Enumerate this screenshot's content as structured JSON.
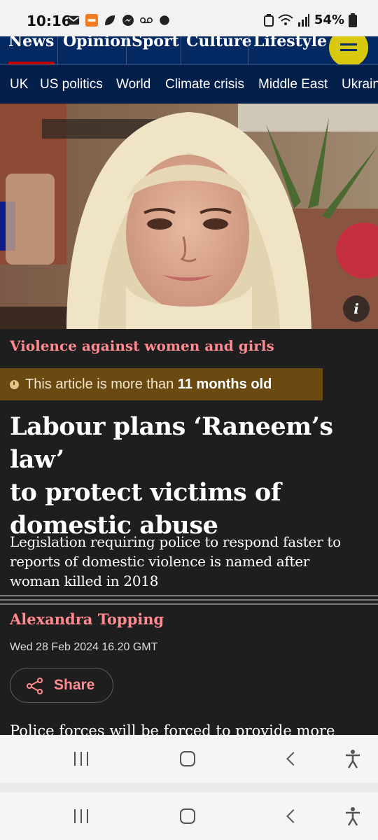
{
  "status_bar": {
    "time": "10:16",
    "battery": "54%",
    "icons_left": [
      "mail-icon",
      "temu-icon",
      "leaf-icon",
      "messenger-icon",
      "voicemail-icon",
      "dot-icon"
    ],
    "icons_right": [
      "battery-saver-icon",
      "wifi-icon",
      "signal-icon",
      "battery-icon"
    ]
  },
  "pillars": [
    "News",
    "Opinion",
    "Sport",
    "Culture",
    "Lifestyle"
  ],
  "subnav": [
    "UK",
    "US politics",
    "World",
    "Climate crisis",
    "Middle East",
    "Ukraine"
  ],
  "colors": {
    "brand_blue": "#052962",
    "kicker": "#ff8a8f",
    "menu_yellow": "#ffe500",
    "age_banner": "#6b4a12",
    "background": "#1e1e1e"
  },
  "hero": {
    "info_label": "i"
  },
  "article": {
    "kicker": "Violence against women and girls",
    "age_prefix": "This article is more than",
    "age_value": "11 months old",
    "headline_lines": [
      "Labour plans ‘Raneem’s law’",
      "to protect victims of",
      "domestic abuse"
    ],
    "standfirst_lines": [
      "Legislation requiring police to respond faster to",
      "reports of domestic violence is named after",
      "woman killed in 2018"
    ],
    "byline": "Alexandra Topping",
    "date": "Wed 28 Feb 2024 16.20 GMT",
    "share_label": "Share",
    "body_start": "Police forces will be forced to provide more"
  }
}
